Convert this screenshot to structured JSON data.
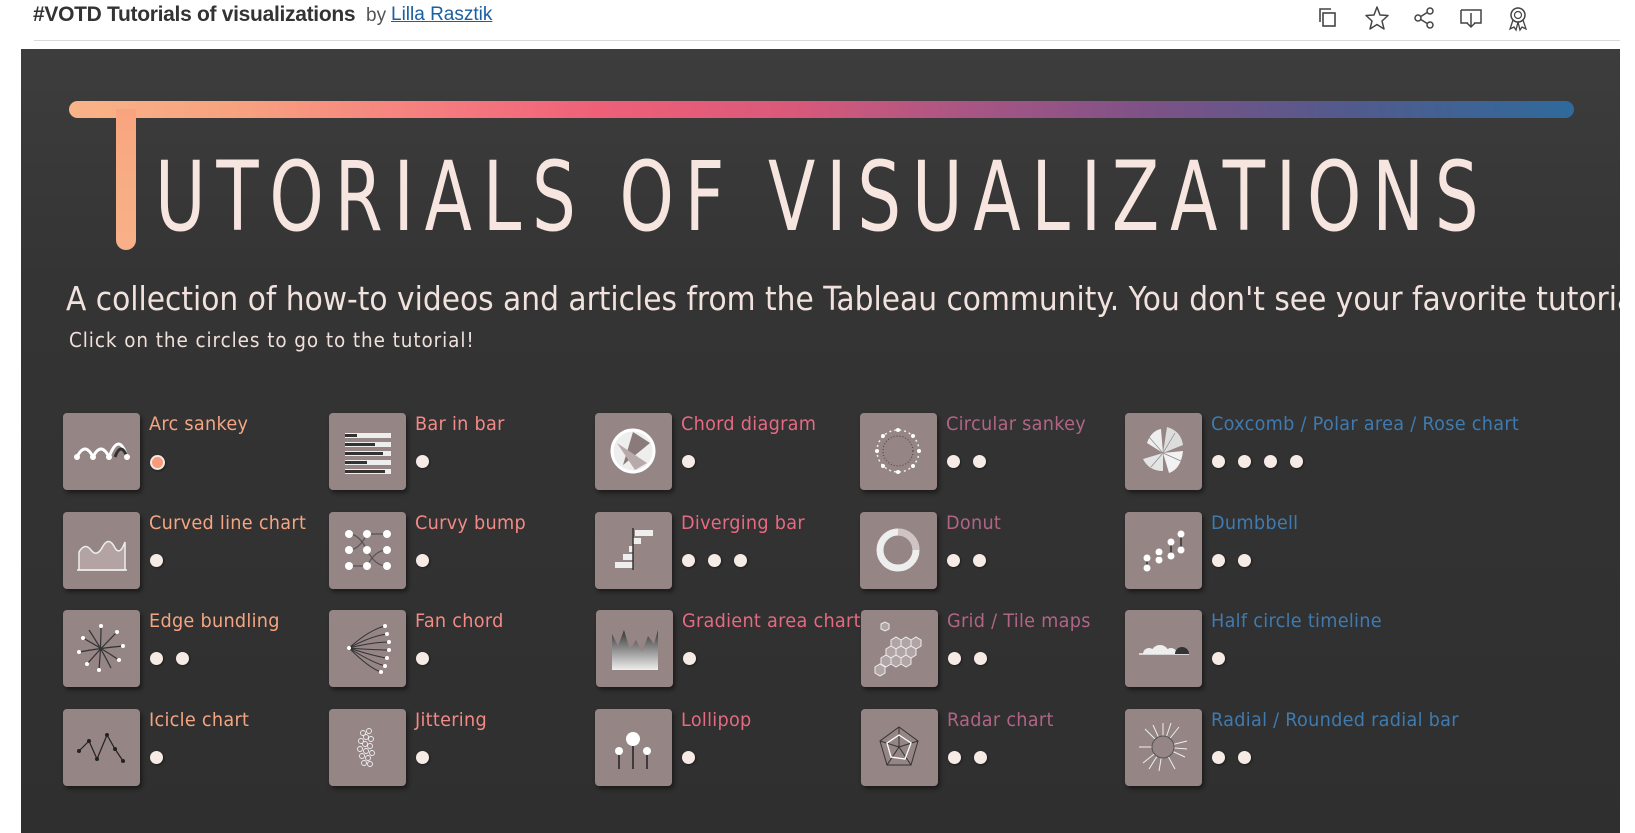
{
  "header": {
    "title": "#VOTD Tutorials of visualizations",
    "by": "by",
    "author": "Lilla Rasztik",
    "icons": [
      "copy-icon",
      "star-icon",
      "share-icon",
      "download-icon",
      "award-icon"
    ]
  },
  "dashboard": {
    "headline": "UTORIALS OF VISUALIZATIONS",
    "subtitle": "A collection of how-to videos and articles from the Tableau community. You don't see your favorite tutorial? Drop me a message!",
    "hint": "Click on the circles to go to the tutorial!",
    "colors": {
      "background": "#353535",
      "tile": "#958585",
      "gradient_start": "#f9b488",
      "gradient_mid": "#ef6078",
      "gradient_end": "#2f6a9c"
    },
    "items": [
      {
        "label": "Arc sankey",
        "dots": 1,
        "color": "#f5a582",
        "icon": "arc-sankey-icon"
      },
      {
        "label": "Bar in bar",
        "dots": 1,
        "color": "#f38a86",
        "icon": "bar-in-bar-icon"
      },
      {
        "label": "Chord diagram",
        "dots": 1,
        "color": "#e56a82",
        "icon": "chord-diagram-icon"
      },
      {
        "label": "Circular sankey",
        "dots": 2,
        "color": "#b06585",
        "icon": "circular-sankey-icon"
      },
      {
        "label": "Coxcomb / Polar area / Rose chart",
        "dots": 4,
        "color": "#3f7bb0",
        "icon": "coxcomb-icon"
      },
      {
        "label": "Curved line chart",
        "dots": 1,
        "color": "#f5a582",
        "icon": "curved-line-chart-icon"
      },
      {
        "label": "Curvy bump",
        "dots": 1,
        "color": "#f38a86",
        "icon": "curvy-bump-icon"
      },
      {
        "label": "Diverging bar",
        "dots": 3,
        "color": "#e56a82",
        "icon": "diverging-bar-icon"
      },
      {
        "label": "Donut",
        "dots": 2,
        "color": "#b06585",
        "icon": "donut-icon"
      },
      {
        "label": "Dumbbell",
        "dots": 2,
        "color": "#3f7bb0",
        "icon": "dumbbell-icon"
      },
      {
        "label": "Edge bundling",
        "dots": 2,
        "color": "#f5a582",
        "icon": "edge-bundling-icon"
      },
      {
        "label": "Fan chord",
        "dots": 1,
        "color": "#f38a86",
        "icon": "fan-chord-icon"
      },
      {
        "label": "Gradient area chart",
        "dots": 1,
        "color": "#e56a82",
        "icon": "gradient-area-chart-icon"
      },
      {
        "label": "Grid / Tile maps",
        "dots": 2,
        "color": "#b06585",
        "icon": "tile-map-icon"
      },
      {
        "label": "Half circle timeline",
        "dots": 1,
        "color": "#3f7bb0",
        "icon": "half-circle-timeline-icon"
      },
      {
        "label": "Icicle chart",
        "dots": 1,
        "color": "#f5a582",
        "icon": "icicle-chart-icon"
      },
      {
        "label": "Jittering",
        "dots": 1,
        "color": "#f38a86",
        "icon": "jittering-icon"
      },
      {
        "label": "Lollipop",
        "dots": 1,
        "color": "#e56a82",
        "icon": "lollipop-icon"
      },
      {
        "label": "Radar chart",
        "dots": 2,
        "color": "#b06585",
        "icon": "radar-chart-icon"
      },
      {
        "label": "Radial / Rounded radial bar",
        "dots": 2,
        "color": "#3f7bb0",
        "icon": "radial-bar-icon"
      }
    ]
  }
}
